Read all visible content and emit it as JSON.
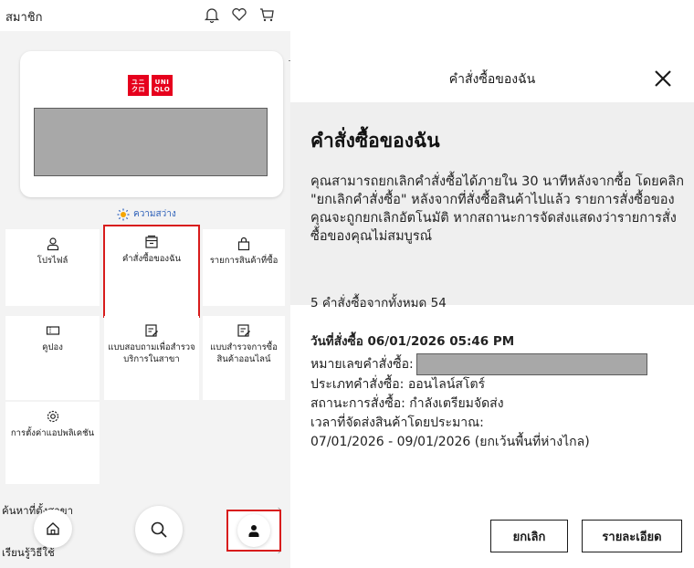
{
  "left": {
    "header_title": "สมาชิก",
    "logo_top": "ユニ\nクロ",
    "logo_bottom": "UNI\nQLO",
    "brightness_label": "ความสว่าง",
    "tiles": [
      {
        "label": "โปรไฟล์",
        "icon": "profile-icon"
      },
      {
        "label": "คำสั่งซื้อของฉัน",
        "icon": "order-box-icon"
      },
      {
        "label": "รายการสินค้าที่ซื้อ",
        "icon": "shopping-bag-icon"
      },
      {
        "label": "คูปอง",
        "icon": "coupon-icon"
      },
      {
        "label": "แบบสอบถามเพื่อสำรวจบริการในสาขา",
        "icon": "survey-icon"
      },
      {
        "label": "แบบสำรวจการซื้อสินค้าออนไลน์",
        "icon": "survey-online-icon"
      },
      {
        "label": "การตั้งค่าแอปพลิเคชัน",
        "icon": "settings-gear-icon"
      }
    ],
    "nav_store_search": "ค้นหาที่ตั้งสาขา",
    "nav_how_to": "เรียนรู้วิธีใช้",
    "accent_red": "#d81c1c",
    "brand_red": "#e6001d"
  },
  "modal": {
    "header_title": "คำสั่งซื้อของฉัน",
    "heading": "คำสั่งซื้อของฉัน",
    "info_text": "คุณสามารถยกเลิกคำสั่งซื้อได้ภายใน 30 นาทีหลังจากซื้อ โดยคลิก \"ยกเลิกคำสั่งซื้อ\" หลังจากที่สั่งซื้อสินค้าไปแล้ว รายการสั่งซื้อของคุณจะถูกยกเลิกอัตโนมัติ หากสถานะการจัดส่งแสดงว่ารายการสั่งซื้อของคุณไม่สมบูรณ์",
    "count_text": "5 คำสั่งซื้อจากทั้งหมด 54",
    "order": {
      "date_line": "วันที่สั่งซื้อ 06/01/2026 05:46 PM",
      "number_label": "หมายเลขคำสั่งซื้อ:",
      "type_line": "ประเภทคำสั่งซื้อ: ออนไลน์สโตร์",
      "status_line": "สถานะการสั่งซื้อ: กำลังเตรียมจัดส่ง",
      "delivery_label": "เวลาที่จัดส่งสินค้าโดยประมาณ:",
      "delivery_range": "07/01/2026 - 09/01/2026 (ยกเว้นพื้นที่ห่างไกล)"
    },
    "cancel_label": "ยกเลิก",
    "details_label": "รายละเอียด"
  }
}
